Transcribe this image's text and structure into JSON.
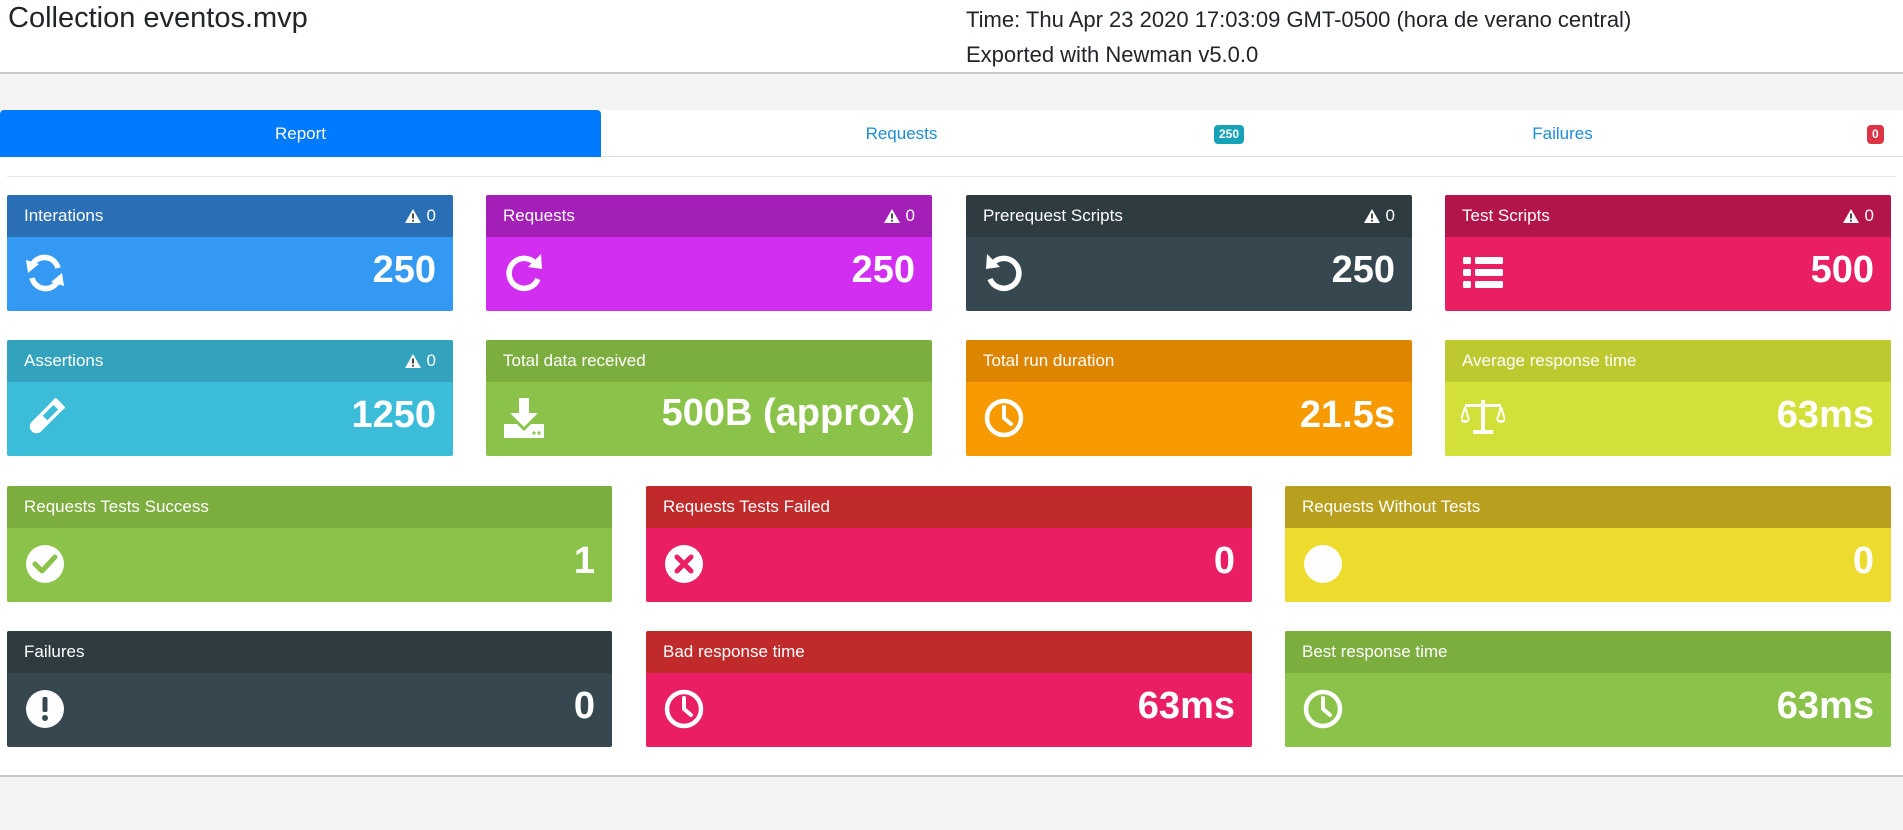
{
  "header": {
    "title": "Collection eventos.mvp",
    "time": "Time: Thu Apr 23 2020 17:03:09 GMT-0500 (hora de verano central)",
    "exported": "Exported with Newman v5.0.0"
  },
  "tabs": [
    {
      "label": "Report",
      "active": true
    },
    {
      "label": "Requests",
      "badge": "250"
    },
    {
      "label": "Failures",
      "badge": "0"
    }
  ],
  "cards": {
    "iterations": {
      "label": "Interations",
      "warn": "0",
      "value": "250",
      "icon": "sync-icon",
      "head_color": "#2a6fb5",
      "body_color": "#3399f2"
    },
    "requests": {
      "label": "Requests",
      "warn": "0",
      "value": "250",
      "icon": "redo-icon",
      "head_color": "#a31fb8",
      "body_color": "#d22ef2"
    },
    "prerequest": {
      "label": "Prerequest Scripts",
      "warn": "0",
      "value": "250",
      "icon": "undo-icon",
      "head_color": "#2e3b41",
      "body_color": "#37474f"
    },
    "testscripts": {
      "label": "Test Scripts",
      "warn": "0",
      "value": "500",
      "icon": "list-icon",
      "head_color": "#b31449",
      "body_color": "#e91e63"
    },
    "assertions": {
      "label": "Assertions",
      "warn": "0",
      "value": "1250",
      "icon": "flask-icon",
      "head_color": "#33a3bd",
      "body_color": "#3bbcd9"
    },
    "datareceived": {
      "label": "Total data received",
      "value": "500B (approx)",
      "icon": "download-icon",
      "head_color": "#7cae3f",
      "body_color": "#8bc34a"
    },
    "duration": {
      "label": "Total run duration",
      "value": "21.5s",
      "icon": "clock-icon",
      "head_color": "#de8500",
      "body_color": "#f69a00"
    },
    "avgresponse": {
      "label": "Average response time",
      "value": "63ms",
      "icon": "balance-scale-icon",
      "head_color": "#bec92f",
      "body_color": "#d4e03a"
    },
    "testsuccess": {
      "label": "Requests Tests Success",
      "value": "1",
      "icon": "check-circle-icon",
      "head_color": "#7cae3f",
      "body_color": "#8bc34a"
    },
    "testfailed": {
      "label": "Requests Tests Failed",
      "value": "0",
      "icon": "times-circle-icon",
      "head_color": "#c12a2a",
      "body_color": "#e91e63"
    },
    "withouttests": {
      "label": "Requests Without Tests",
      "value": "0",
      "icon": "circle-icon",
      "head_color": "#b8a01e",
      "body_color": "#eddb2e"
    },
    "failures": {
      "label": "Failures",
      "value": "0",
      "icon": "exclamation-circle-icon",
      "head_color": "#2e3b41",
      "body_color": "#37474f"
    },
    "badresponse": {
      "label": "Bad response time",
      "value": "63ms",
      "icon": "clock-icon",
      "head_color": "#c12a2a",
      "body_color": "#e91e63"
    },
    "bestresponse": {
      "label": "Best response time",
      "value": "63ms",
      "icon": "clock-icon",
      "head_color": "#7cae3f",
      "body_color": "#8bc34a"
    }
  }
}
